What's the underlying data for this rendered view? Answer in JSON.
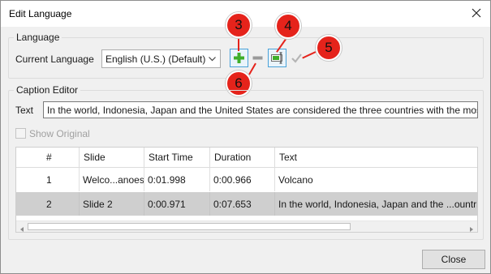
{
  "window": {
    "title": "Edit Language",
    "close_icon": "close-icon"
  },
  "language_group": {
    "legend": "Language",
    "current_language_label": "Current Language",
    "current_language_value": "English (U.S.) (Default)",
    "buttons": {
      "add_icon": "plus-icon",
      "remove_icon": "minus-icon",
      "rename_icon": "edit-language-icon",
      "set_default_icon": "checkmark-icon"
    }
  },
  "callouts": {
    "c3": "3",
    "c4": "4",
    "c5": "5",
    "c6": "6"
  },
  "caption_group": {
    "legend": "Caption Editor",
    "text_label": "Text",
    "text_value": "In the world, Indonesia, Japan and the United States are considered the three countries with the most",
    "show_original_label": "Show Original",
    "show_original_checked": false
  },
  "table": {
    "columns": [
      "#",
      "Slide",
      "Start Time",
      "Duration",
      "Text"
    ],
    "rows": [
      {
        "num": "1",
        "slide": "Welco...anoes",
        "start": "0:01.998",
        "duration": "0:00.966",
        "text": "Volcano",
        "selected": false
      },
      {
        "num": "2",
        "slide": "Slide 2",
        "start": "0:00.971",
        "duration": "0:07.653",
        "text": "In the world, Indonesia, Japan and the ...ountries",
        "selected": true
      }
    ]
  },
  "footer": {
    "close_label": "Close"
  },
  "colors": {
    "callout": "#e5231b",
    "plus_green": "#3fae2a",
    "selection": "#cfcfcf",
    "focus_blue": "#4aa2d8"
  }
}
